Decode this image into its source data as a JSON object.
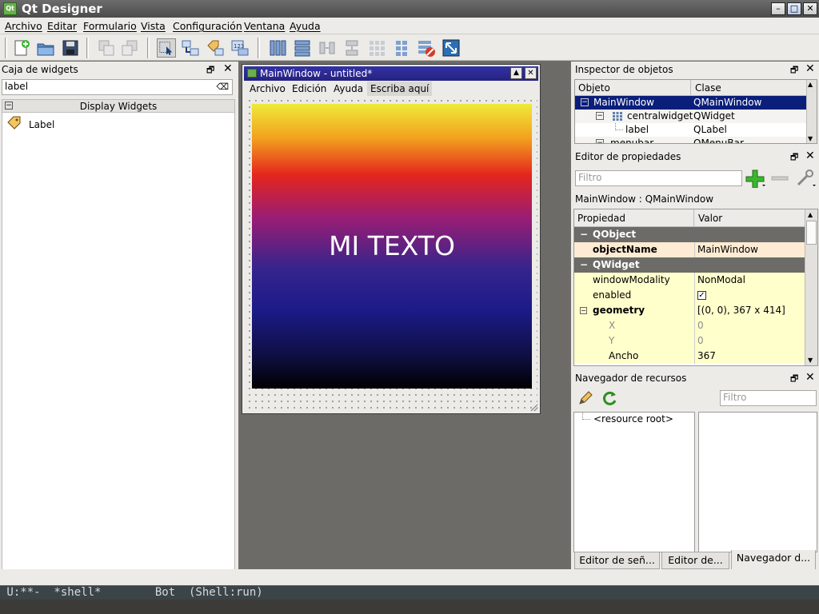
{
  "app": {
    "title": "Qt Designer",
    "icon_text": "Qt"
  },
  "menubar": [
    "Archivo",
    "Editar",
    "Formulario",
    "Vista",
    "Configuración",
    "Ventana",
    "Ayuda"
  ],
  "widget_box": {
    "title": "Caja de widgets",
    "filter_value": "label",
    "category": "Display Widgets",
    "items": [
      {
        "label": "Label"
      }
    ]
  },
  "form": {
    "title": "MainWindow - untitled*",
    "menus": [
      "Archivo",
      "Edición",
      "Ayuda",
      "Escriba aquí"
    ],
    "label_text": "MI TEXTO"
  },
  "object_inspector": {
    "title": "Inspector de objetos",
    "headers": [
      "Objeto",
      "Clase"
    ],
    "rows": [
      {
        "object": "MainWindow",
        "class": "QMainWindow"
      },
      {
        "object": "centralwidget",
        "class": "QWidget"
      },
      {
        "object": "label",
        "class": "QLabel"
      },
      {
        "object": "menubar",
        "class": "QMenuBar"
      }
    ]
  },
  "property_editor": {
    "title": "Editor de propiedades",
    "filter_placeholder": "Filtro",
    "context": "MainWindow : QMainWindow",
    "headers": [
      "Propiedad",
      "Valor"
    ],
    "rows": [
      {
        "name": "QObject",
        "value": ""
      },
      {
        "name": "objectName",
        "value": "MainWindow"
      },
      {
        "name": "QWidget",
        "value": ""
      },
      {
        "name": "windowModality",
        "value": "NonModal"
      },
      {
        "name": "enabled",
        "value": ""
      },
      {
        "name": "geometry",
        "value": "[(0, 0), 367 x 414]"
      },
      {
        "name": "X",
        "value": "0"
      },
      {
        "name": "Y",
        "value": "0"
      },
      {
        "name": "Ancho",
        "value": "367"
      }
    ]
  },
  "resource_browser": {
    "title": "Navegador de recursos",
    "filter_placeholder": "Filtro",
    "root": "<resource root>",
    "tabs": [
      "Editor de señ...",
      "Editor de...",
      "Navegador d..."
    ]
  },
  "emacs_modeline": {
    "text": " U:**-  *shell*        Bot  (Shell:run)"
  },
  "icons": {
    "close": "close-icon",
    "float": "float-icon"
  },
  "colors": {
    "selection": "#0a1e7a",
    "form_title": "#2b2a9c",
    "property_yellow": "#ffffcc"
  }
}
